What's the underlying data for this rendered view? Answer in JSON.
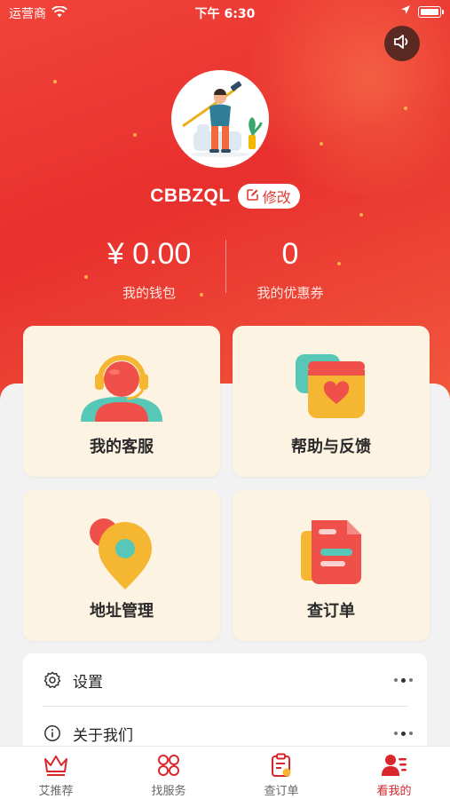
{
  "status_bar": {
    "carrier": "运营商",
    "time": "下午 6:30"
  },
  "profile": {
    "username": "CBBZQL",
    "edit_label": "修改"
  },
  "stats": {
    "wallet_value": "¥ 0.00",
    "wallet_label": "我的钱包",
    "coupon_value": "0",
    "coupon_label": "我的优惠券"
  },
  "cards": [
    {
      "label": "我的客服",
      "icon": "customer-service-icon"
    },
    {
      "label": "帮助与反馈",
      "icon": "help-feedback-icon"
    },
    {
      "label": "地址管理",
      "icon": "address-pin-icon"
    },
    {
      "label": "查订单",
      "icon": "order-document-icon"
    }
  ],
  "menu": [
    {
      "label": "设置",
      "icon": "gear-icon"
    },
    {
      "label": "关于我们",
      "icon": "info-icon"
    }
  ],
  "tabs": [
    {
      "label": "艾推荐",
      "icon": "crown-icon",
      "active": false
    },
    {
      "label": "找服务",
      "icon": "grid-services-icon",
      "active": false
    },
    {
      "label": "查订单",
      "icon": "clipboard-order-icon",
      "active": false
    },
    {
      "label": "看我的",
      "icon": "profile-icon",
      "active": true
    }
  ],
  "colors": {
    "brand_red": "#e8302e",
    "card_cream": "#fdf3e3",
    "active_tab": "#d8262a"
  }
}
